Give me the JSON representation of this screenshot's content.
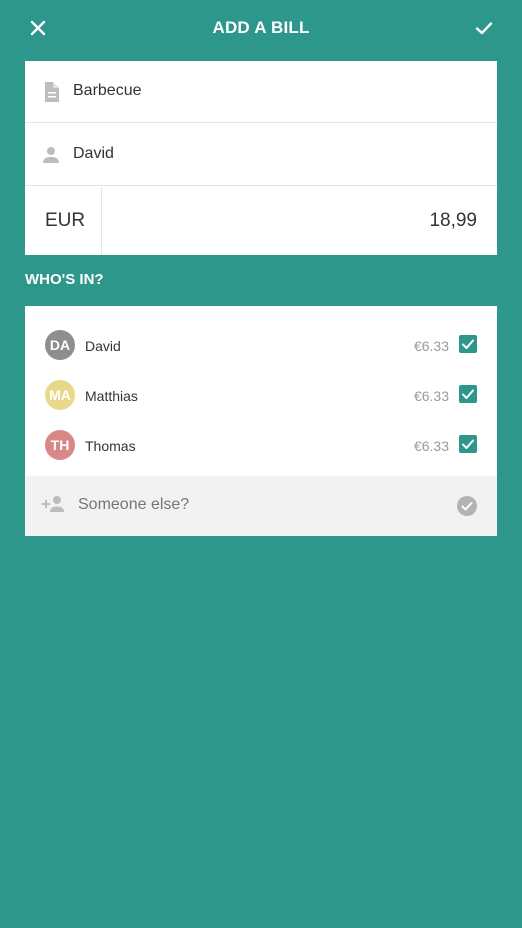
{
  "header": {
    "title": "ADD A BILL",
    "close_icon": "close-icon",
    "confirm_icon": "check-icon"
  },
  "form": {
    "description": "Barbecue",
    "payer": "David",
    "currency": "EUR",
    "amount": "18,99"
  },
  "participants": {
    "heading": "WHO'S IN?",
    "people": [
      {
        "initials": "DA",
        "name": "David",
        "share": "€6.33",
        "checked": true,
        "color": "#8e8e8e"
      },
      {
        "initials": "MA",
        "name": "Matthias",
        "share": "€6.33",
        "checked": true,
        "color": "#e8d98a"
      },
      {
        "initials": "TH",
        "name": "Thomas",
        "share": "€6.33",
        "checked": true,
        "color": "#d98888"
      }
    ],
    "add_placeholder": "Someone else?"
  },
  "colors": {
    "background": "#2e978b",
    "accent": "#2e978b"
  }
}
